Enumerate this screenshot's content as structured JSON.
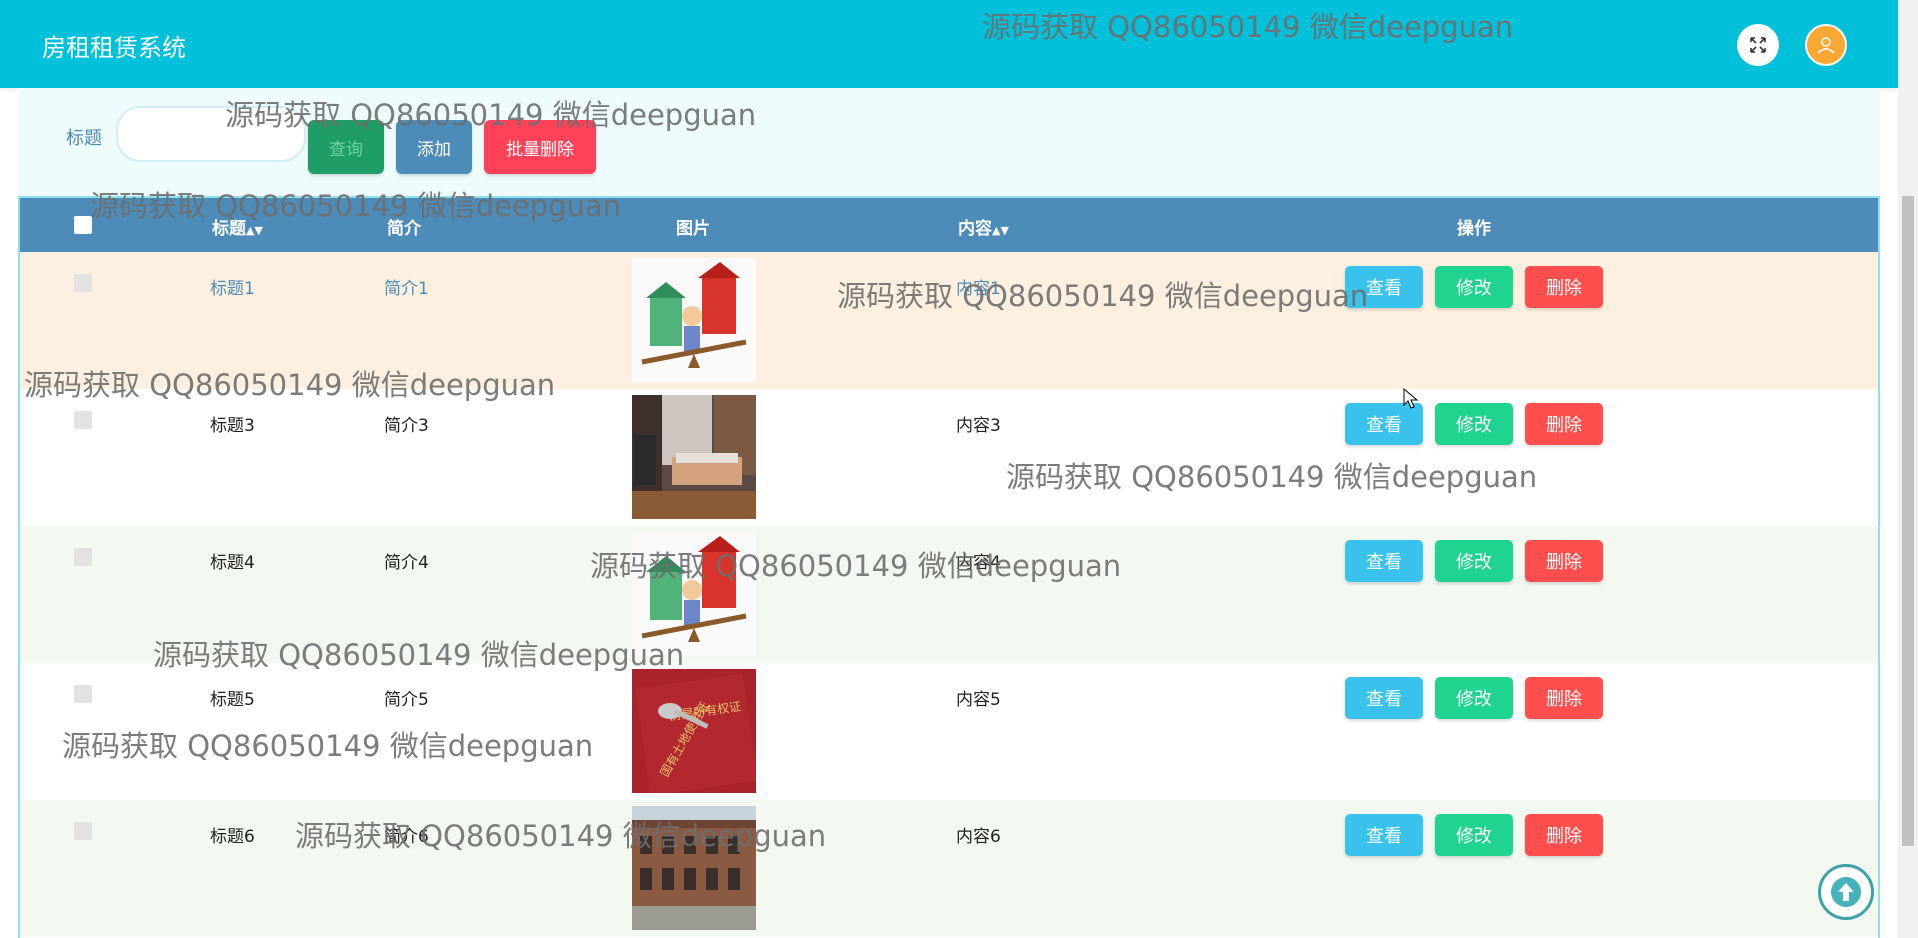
{
  "header": {
    "app_title": "房租租赁系统",
    "fullscreen_icon": "expand-arrows-icon",
    "avatar_icon": "user-icon",
    "bg_color": "#00c1d9"
  },
  "search": {
    "label": "标题",
    "input_value": "",
    "query_button": "查询",
    "add_button": "添加",
    "batch_delete_button": "批量删除"
  },
  "table": {
    "columns": {
      "title": "标题",
      "intro": "简介",
      "image": "图片",
      "content": "内容",
      "actions": "操作"
    },
    "sort_icon": "sort-arrows-icon",
    "rows": [
      {
        "title": "标题1",
        "intro": "简介1",
        "content": "内容1",
        "image": "cartoon-house-image",
        "highlighted": true
      },
      {
        "title": "标题3",
        "intro": "简介3",
        "content": "内容3",
        "image": "bedroom-photo-image",
        "highlighted": false
      },
      {
        "title": "标题4",
        "intro": "简介4",
        "content": "内容4",
        "image": "cartoon-house-image",
        "highlighted": false
      },
      {
        "title": "标题5",
        "intro": "简介5",
        "content": "内容5",
        "image": "property-certificate-keys-image",
        "highlighted": false
      },
      {
        "title": "标题6",
        "intro": "简介6",
        "content": "内容6",
        "image": "building-facade-image",
        "highlighted": false
      }
    ],
    "row_buttons": {
      "view": "查看",
      "edit": "修改",
      "delete": "删除"
    },
    "header_color": "#4d8bb8",
    "highlight_color": "#fdf0e0",
    "alt_row_color": "#f3f8f1"
  },
  "back_to_top_icon": "arrow-up-circle-icon",
  "watermarks": [
    "源码获取 QQ86050149 微信deepguan",
    "源码获取 QQ86050149 微信deepguan",
    "源码获取 QQ86050149 微信deepguan",
    "源码获取 QQ86050149 微信deepguan",
    "源码获取 QQ86050149 微信deepguan",
    "源码获取 QQ86050149 微信deepguan",
    "源码获取 QQ86050149 微信deepguan",
    "源码获取 QQ86050149 微信deepguan",
    "源码获取 QQ86050149 微信deepguan",
    "源码获取 QQ86050149 微信deepguan"
  ]
}
